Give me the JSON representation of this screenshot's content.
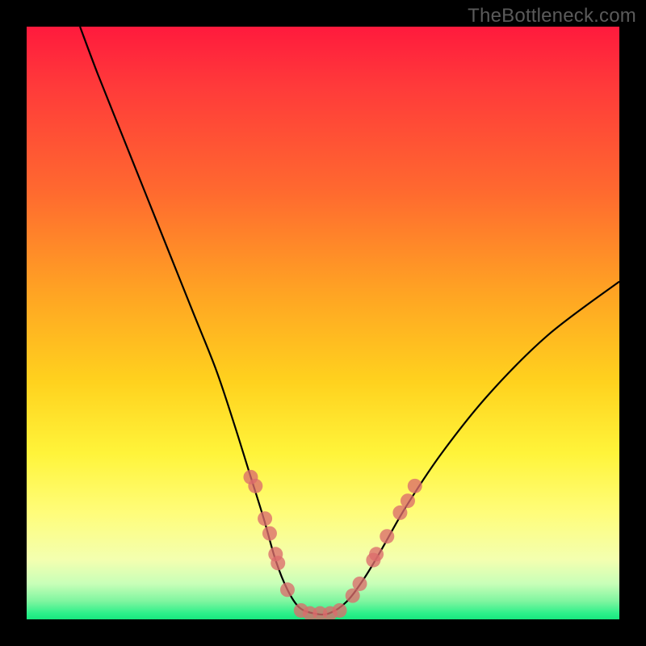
{
  "watermark": "TheBottleneck.com",
  "chart_data": {
    "type": "line",
    "title": "",
    "xlabel": "",
    "ylabel": "",
    "xlim": [
      0,
      100
    ],
    "ylim": [
      0,
      100
    ],
    "grid": false,
    "legend": false,
    "background": "rainbow-gradient-vertical",
    "series": [
      {
        "name": "bottleneck-curve",
        "x": [
          9,
          12,
          16,
          20,
          24,
          28,
          32,
          35,
          37.5,
          40,
          42,
          44,
          46,
          48.5,
          51,
          54,
          57,
          60,
          64,
          70,
          78,
          88,
          100
        ],
        "y": [
          100,
          92,
          82,
          72,
          62,
          52,
          42,
          33,
          25,
          17,
          10,
          5,
          2,
          1,
          1,
          3,
          7,
          12,
          19,
          28,
          38,
          48,
          57
        ]
      }
    ],
    "markers": {
      "name": "highlight-dots",
      "points": [
        {
          "x": 37.8,
          "y": 24
        },
        {
          "x": 38.6,
          "y": 22.5
        },
        {
          "x": 40.2,
          "y": 17
        },
        {
          "x": 41,
          "y": 14.5
        },
        {
          "x": 42,
          "y": 11
        },
        {
          "x": 42.4,
          "y": 9.5
        },
        {
          "x": 44,
          "y": 5
        },
        {
          "x": 46.3,
          "y": 1.5
        },
        {
          "x": 47.8,
          "y": 1
        },
        {
          "x": 49.5,
          "y": 1
        },
        {
          "x": 51.2,
          "y": 1
        },
        {
          "x": 52.8,
          "y": 1.5
        },
        {
          "x": 55,
          "y": 4
        },
        {
          "x": 56.2,
          "y": 6
        },
        {
          "x": 58.5,
          "y": 10
        },
        {
          "x": 59,
          "y": 11
        },
        {
          "x": 60.8,
          "y": 14
        },
        {
          "x": 63,
          "y": 18
        },
        {
          "x": 64.3,
          "y": 20
        },
        {
          "x": 65.5,
          "y": 22.5
        }
      ]
    }
  },
  "colors": {
    "frame": "#000000",
    "curve": "#000000",
    "dot": "#db6b6b",
    "watermark": "#5a5a5a"
  }
}
